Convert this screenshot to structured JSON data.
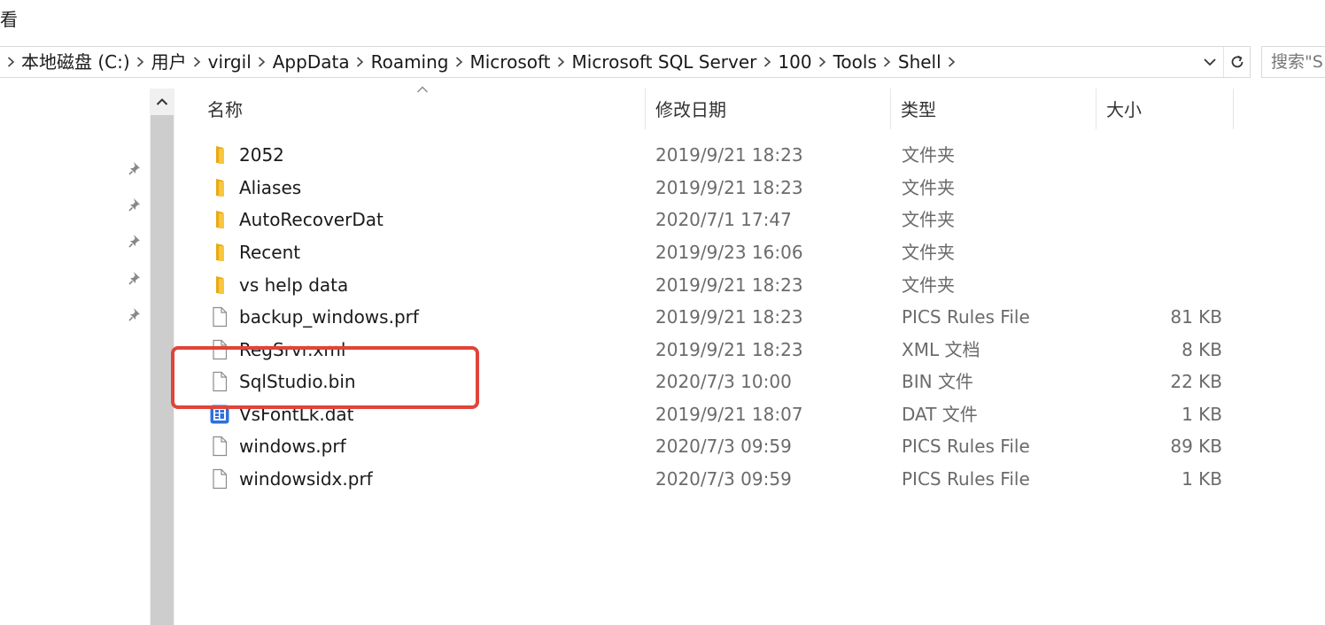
{
  "ribbon": {
    "tab_fragment": "看"
  },
  "breadcrumb": [
    "本地磁盘 (C:)",
    "用户",
    "virgil",
    "AppData",
    "Roaming",
    "Microsoft",
    "Microsoft SQL Server",
    "100",
    "Tools",
    "Shell"
  ],
  "search": {
    "placeholder": "搜索\"Shell\"",
    "visible_text": "搜索\"S"
  },
  "columns": {
    "name": "名称",
    "date": "修改日期",
    "type": "类型",
    "size": "大小"
  },
  "files": [
    {
      "name": "2052",
      "date": "2019/9/21 18:23",
      "type": "文件夹",
      "size": "",
      "icon": "folder-icon"
    },
    {
      "name": "Aliases",
      "date": "2019/9/21 18:23",
      "type": "文件夹",
      "size": "",
      "icon": "folder-icon"
    },
    {
      "name": "AutoRecoverDat",
      "date": "2020/7/1 17:47",
      "type": "文件夹",
      "size": "",
      "icon": "folder-icon"
    },
    {
      "name": "Recent",
      "date": "2019/9/23 16:06",
      "type": "文件夹",
      "size": "",
      "icon": "folder-icon"
    },
    {
      "name": "vs help data",
      "date": "2019/9/21 18:23",
      "type": "文件夹",
      "size": "",
      "icon": "folder-icon"
    },
    {
      "name": "backup_windows.prf",
      "date": "2019/9/21 18:23",
      "type": "PICS Rules File",
      "size": "81 KB",
      "icon": "file-icon"
    },
    {
      "name": "RegSrvr.xml",
      "date": "2019/9/21 18:23",
      "type": "XML 文档",
      "size": "8 KB",
      "icon": "file-icon"
    },
    {
      "name": "SqlStudio.bin",
      "date": "2020/7/3 10:00",
      "type": "BIN 文件",
      "size": "22 KB",
      "icon": "file-icon"
    },
    {
      "name": "VsFontLk.dat",
      "date": "2019/9/21 18:07",
      "type": "DAT 文件",
      "size": "1 KB",
      "icon": "dat-file-icon"
    },
    {
      "name": "windows.prf",
      "date": "2020/7/3 09:59",
      "type": "PICS Rules File",
      "size": "89 KB",
      "icon": "file-icon"
    },
    {
      "name": "windowsidx.prf",
      "date": "2020/7/3 09:59",
      "type": "PICS Rules File",
      "size": "1 KB",
      "icon": "file-icon"
    }
  ],
  "colors": {
    "highlight": "#e0443a",
    "folder": "#f8c73f",
    "dat_icon": "#2f6fde"
  },
  "annotation": {
    "highlighted_file": "SqlStudio.bin"
  }
}
